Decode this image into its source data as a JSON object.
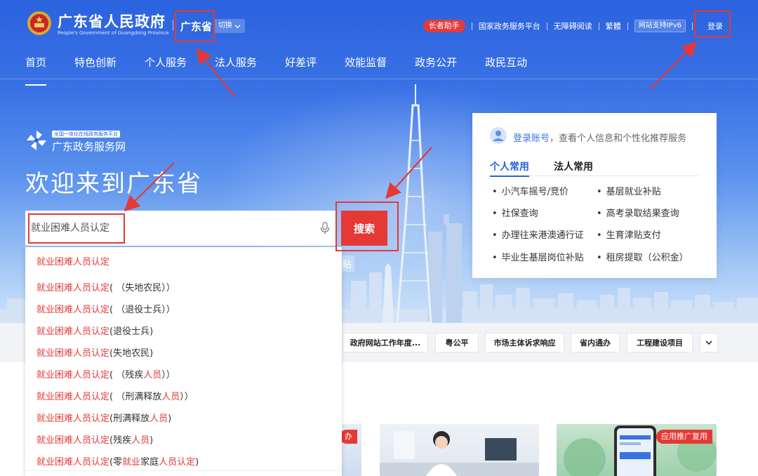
{
  "header": {
    "site_name": "广东省人民政府",
    "site_name_en": "People's Government of Guangdong Province",
    "region": "广东省",
    "switch_label": "切换",
    "utility": {
      "elder_mode": "长者助手",
      "national_platform": "国家政务服务平台",
      "accessibility": "无障碍阅读",
      "traditional": "繁體",
      "ipv6": "网站支持IPv6",
      "login": "登录"
    }
  },
  "nav": {
    "items": [
      "首页",
      "特色创新",
      "个人服务",
      "法人服务",
      "好差评",
      "效能监督",
      "政务公开",
      "政民互动"
    ],
    "active_index": 0
  },
  "brand": {
    "tagline": "全国一体化在线政务服务平台",
    "name": "广东政务服务网"
  },
  "welcome": "欢迎来到广东省",
  "search": {
    "value": "就业困难人员认定",
    "button": "搜索",
    "background_fragment": "贴"
  },
  "suggestions": [
    {
      "prefix": "就业困难人员认定",
      "rest": [
        [
          "( （失地农民））",
          false
        ]
      ]
    },
    {
      "prefix": "就业困难人员认定",
      "rest": [
        [
          "( （退役士兵））",
          false
        ]
      ]
    },
    {
      "prefix": "就业困难人员认定",
      "rest": [
        [
          "(退役士兵)",
          false
        ]
      ]
    },
    {
      "prefix": "就业困难人员认定",
      "rest": [
        [
          "(失地农民)",
          false
        ]
      ]
    },
    {
      "prefix": "就业困难人员认定",
      "rest": [
        [
          "( （残疾",
          false
        ],
        [
          "人员",
          true
        ],
        [
          "））",
          false
        ]
      ]
    },
    {
      "prefix": "就业困难人员认定",
      "rest": [
        [
          "( （刑满释放",
          false
        ],
        [
          "人员",
          true
        ],
        [
          "））",
          false
        ]
      ]
    },
    {
      "prefix": "就业困难人员认定",
      "rest": [
        [
          "(刑满释放",
          false
        ],
        [
          "人员",
          true
        ],
        [
          ")",
          false
        ]
      ]
    },
    {
      "prefix": "就业困难人员认定",
      "rest": [
        [
          "(残疾",
          false
        ],
        [
          "人员",
          true
        ],
        [
          ")",
          false
        ]
      ]
    },
    {
      "prefix": "就业困难人员认定",
      "rest": [
        [
          "(零",
          false
        ],
        [
          "就业",
          true
        ],
        [
          "家庭",
          false
        ],
        [
          "人员认定",
          true
        ],
        [
          ")",
          false
        ]
      ]
    }
  ],
  "panel": {
    "login_link": "登录账号",
    "login_text": "，查看个人信息和个性化推荐服务",
    "tabs": [
      "个人常用",
      "法人常用"
    ],
    "active_tab": 0,
    "services_left": [
      "小汽车摇号/竞价",
      "社保查询",
      "办理往来港澳通行证",
      "毕业生基层岗位补贴"
    ],
    "services_right": [
      "基层就业补贴",
      "高考录取结果查询",
      "生育津贴支付",
      "租房提取（公积金）"
    ]
  },
  "quick_links": [
    "政府网站工作年度...",
    "粤公平",
    "市场主体诉求响应",
    "省内通办",
    "工程建设项目"
  ],
  "cards": {
    "card1_badge": "办",
    "card3_badge": "应用推广复用"
  },
  "colors": {
    "primary_blue": "#2b62de",
    "accent_red": "#e53935",
    "white": "#ffffff"
  },
  "icons": [
    "national-emblem-icon",
    "chevron-down-icon",
    "microphone-icon",
    "user-avatar-icon",
    "pinwheel-logo-icon"
  ]
}
